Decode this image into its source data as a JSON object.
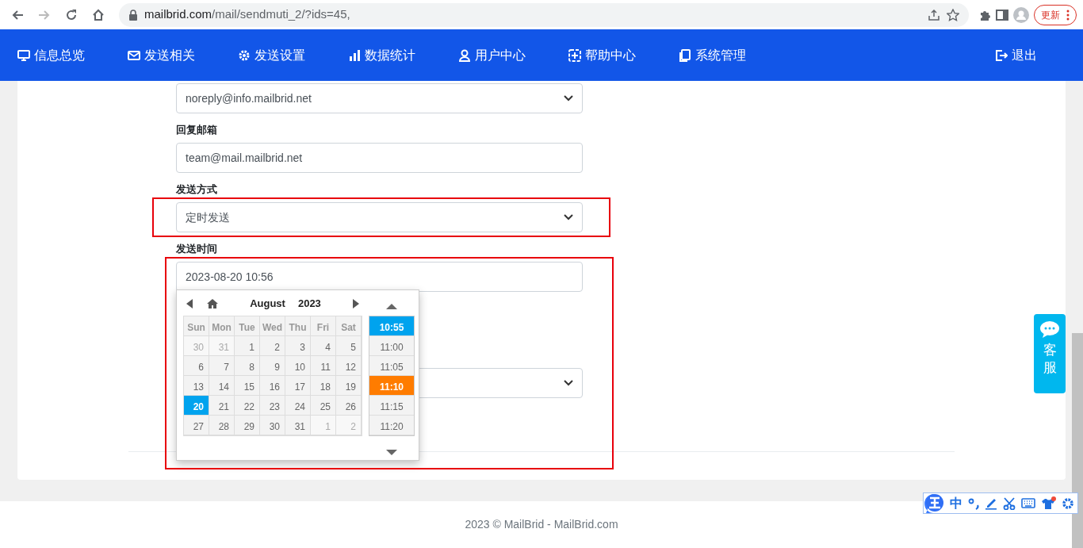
{
  "browser": {
    "url_host": "mailbrid.com",
    "url_path": "/mail/sendmuti_2/?ids=45,",
    "update_button": "更新"
  },
  "nav": {
    "items": [
      {
        "label": "信息总览"
      },
      {
        "label": "发送相关"
      },
      {
        "label": "发送设置"
      },
      {
        "label": "数据统计"
      },
      {
        "label": "用户中心"
      },
      {
        "label": "帮助中心"
      },
      {
        "label": "系统管理"
      }
    ],
    "logout": "退出"
  },
  "form": {
    "sender_value": "noreply@info.mailbrid.net",
    "fields": [
      {
        "label": "回复邮箱",
        "kind": "input",
        "value": "team@mail.mailbrid.net"
      },
      {
        "label": "发送方式",
        "kind": "select",
        "value": "定时发送"
      },
      {
        "label": "发送时间",
        "kind": "input",
        "value": "2023-08-20 10:56"
      }
    ]
  },
  "datepicker": {
    "month": "August",
    "year": "2023",
    "weekdays": [
      "Sun",
      "Mon",
      "Tue",
      "Wed",
      "Thu",
      "Fri",
      "Sat"
    ],
    "days": [
      {
        "label": "30",
        "other_month": true,
        "selected": false
      },
      {
        "label": "31",
        "other_month": true,
        "selected": false
      },
      {
        "label": "1",
        "other_month": false,
        "selected": false
      },
      {
        "label": "2",
        "other_month": false,
        "selected": false
      },
      {
        "label": "3",
        "other_month": false,
        "selected": false
      },
      {
        "label": "4",
        "other_month": false,
        "selected": false
      },
      {
        "label": "5",
        "other_month": false,
        "selected": false
      },
      {
        "label": "6",
        "other_month": false,
        "selected": false
      },
      {
        "label": "7",
        "other_month": false,
        "selected": false
      },
      {
        "label": "8",
        "other_month": false,
        "selected": false
      },
      {
        "label": "9",
        "other_month": false,
        "selected": false
      },
      {
        "label": "10",
        "other_month": false,
        "selected": false
      },
      {
        "label": "11",
        "other_month": false,
        "selected": false
      },
      {
        "label": "12",
        "other_month": false,
        "selected": false
      },
      {
        "label": "13",
        "other_month": false,
        "selected": false
      },
      {
        "label": "14",
        "other_month": false,
        "selected": false
      },
      {
        "label": "15",
        "other_month": false,
        "selected": false
      },
      {
        "label": "16",
        "other_month": false,
        "selected": false
      },
      {
        "label": "17",
        "other_month": false,
        "selected": false
      },
      {
        "label": "18",
        "other_month": false,
        "selected": false
      },
      {
        "label": "19",
        "other_month": false,
        "selected": false
      },
      {
        "label": "20",
        "other_month": false,
        "selected": true
      },
      {
        "label": "21",
        "other_month": false,
        "selected": false
      },
      {
        "label": "22",
        "other_month": false,
        "selected": false
      },
      {
        "label": "23",
        "other_month": false,
        "selected": false
      },
      {
        "label": "24",
        "other_month": false,
        "selected": false
      },
      {
        "label": "25",
        "other_month": false,
        "selected": false
      },
      {
        "label": "26",
        "other_month": false,
        "selected": false
      },
      {
        "label": "27",
        "other_month": false,
        "selected": false
      },
      {
        "label": "28",
        "other_month": false,
        "selected": false
      },
      {
        "label": "29",
        "other_month": false,
        "selected": false
      },
      {
        "label": "30",
        "other_month": false,
        "selected": false
      },
      {
        "label": "31",
        "other_month": false,
        "selected": false
      },
      {
        "label": "1",
        "other_month": true,
        "selected": false
      },
      {
        "label": "2",
        "other_month": true,
        "selected": false
      }
    ],
    "times": [
      {
        "label": "10:55",
        "selected": true,
        "current": false
      },
      {
        "label": "11:00",
        "selected": false,
        "current": false
      },
      {
        "label": "11:05",
        "selected": false,
        "current": false
      },
      {
        "label": "11:10",
        "selected": false,
        "current": true
      },
      {
        "label": "11:15",
        "selected": false,
        "current": false
      },
      {
        "label": "11:20",
        "selected": false,
        "current": false
      }
    ]
  },
  "service_widget": {
    "label": "客服"
  },
  "ime_toolbar": {
    "mode": "中"
  },
  "footer": "2023 © MailBrid - MailBrid.com"
}
